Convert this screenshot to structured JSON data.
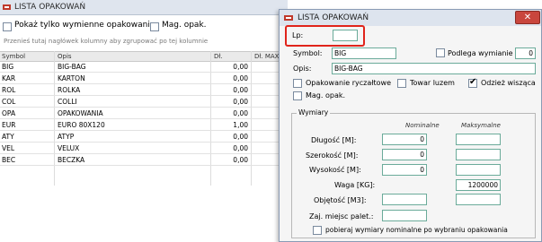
{
  "bg_window": {
    "title": "LISTA OPAKOWAŃ",
    "filter_only_exchanged": "Pokaż tylko wymienne opakowania",
    "filter_mag": "Mag. opak.",
    "group_hint": "Przenieś tutaj nagłówek kolumny aby zgrupować po tej kolumnie",
    "columns": [
      "Symbol",
      "Opis",
      "Dł.",
      "Dł. MAX"
    ],
    "rows": [
      {
        "symbol": "BIG",
        "opis": "BIG-BAG",
        "dl": "0,00"
      },
      {
        "symbol": "KAR",
        "opis": "KARTON",
        "dl": "0,00"
      },
      {
        "symbol": "ROL",
        "opis": "ROLKA",
        "dl": "0,00"
      },
      {
        "symbol": "COL",
        "opis": "COLLI",
        "dl": "0,00"
      },
      {
        "symbol": "OPA",
        "opis": "OPAKOWANIA",
        "dl": "0,00"
      },
      {
        "symbol": "EUR",
        "opis": "EURO 80X120",
        "dl": "1,00"
      },
      {
        "symbol": "ATY",
        "opis": "ATYP",
        "dl": "0,00"
      },
      {
        "symbol": "VEL",
        "opis": "VELUX",
        "dl": "0,00"
      },
      {
        "symbol": "BEC",
        "opis": "BECZKA",
        "dl": "0,00"
      }
    ]
  },
  "dialog": {
    "title": "LISTA OPAKOWAŃ",
    "close_label": "✕",
    "lp_label": "Lp:",
    "lp_value": "",
    "symbol_label": "Symbol:",
    "symbol_value": "BIG",
    "podlega_label": "Podlega wymianie",
    "podlega_value": "0",
    "opis_label": "Opis:",
    "opis_value": "BIG-BAG",
    "opakowanie_ryczaltowe": "Opakowanie ryczałtowe",
    "towar_luzem": "Towar luzem",
    "odziez_wiszaca": "Odzież wisząca",
    "mag_opak": "Mag. opak.",
    "wymiary": {
      "title": "Wymiary",
      "nominal_header": "Nominalne",
      "max_header": "Maksymalne",
      "dlugosc_label": "Długość [M]:",
      "dlugosc_nom": "0",
      "szerokosc_label": "Szerokość [M]:",
      "szerokosc_nom": "0",
      "wysokosc_label": "Wysokość [M]:",
      "wysokosc_nom": "0",
      "waga_label": "Waga [KG]:",
      "waga_max": "1200000",
      "objetosc_label": "Objętość [M3]:",
      "zaj_label": "Zaj. miejsc palet.:",
      "pobieraj_label": "pobieraj wymiary nominalne po wybraniu opakowania"
    }
  },
  "colors": {
    "highlight": "#e0241b",
    "field_border": "#6bab9a",
    "close_button": "#c9463d"
  }
}
